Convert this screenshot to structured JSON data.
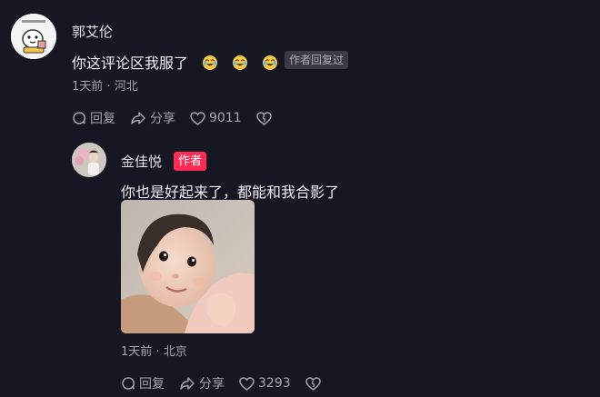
{
  "comment": {
    "username": "郭艾伦",
    "text": "你这评论区我服了",
    "emojis": [
      "laughing-crying-emoji",
      "laughing-crying-emoji",
      "laughing-crying-emoji"
    ],
    "badge": "作者回复过",
    "time": "1天前",
    "location": "河北",
    "actions": {
      "reply": "回复",
      "share": "分享",
      "likes": "9011"
    }
  },
  "reply": {
    "username": "金佳悦",
    "author_badge": "作者",
    "text": "你也是好起来了，都能和我合影了",
    "time": "1天前",
    "location": "北京",
    "actions": {
      "reply": "回复",
      "share": "分享",
      "likes": "3293"
    }
  },
  "colors": {
    "background": "#161722",
    "author_badge": "#fe2c55",
    "meta_text": "#a3a4ae"
  },
  "icons": [
    "reply-bubble-icon",
    "share-arrow-icon",
    "heart-icon",
    "dislike-broken-heart-icon"
  ]
}
